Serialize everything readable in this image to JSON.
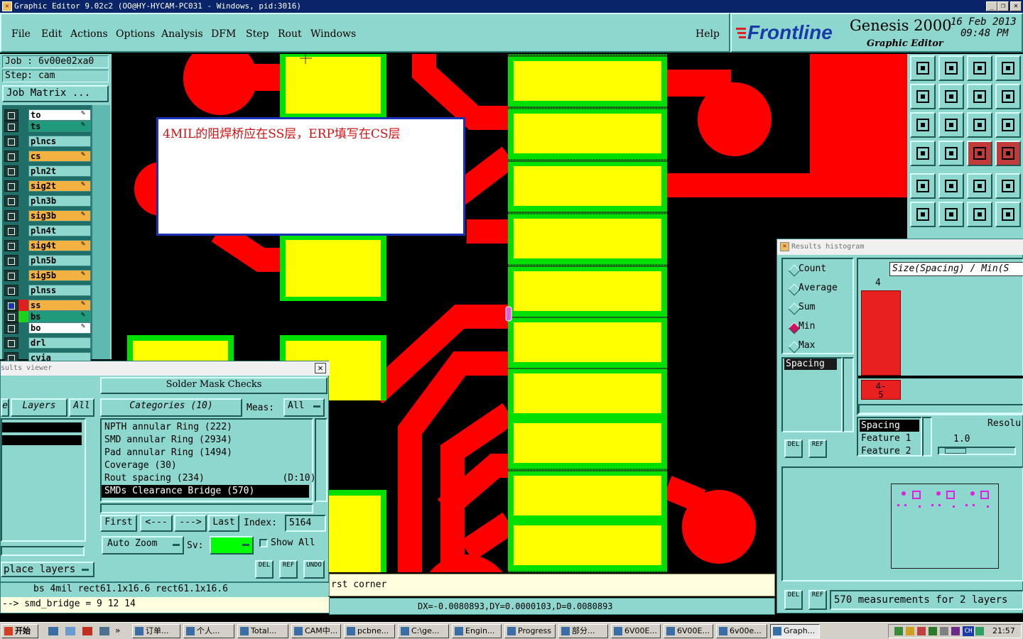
{
  "window": {
    "title": "Graphic Editor 9.02c2 (OO@HY-HYCAM-PC031 - Windows, pid:3016)",
    "buttons": [
      "_",
      "❐",
      "✕"
    ]
  },
  "menu": [
    "File",
    "Edit",
    "Actions",
    "Options",
    "Analysis",
    "DFM",
    "Step",
    "Rout",
    "Windows"
  ],
  "help_label": "Help",
  "brand": {
    "logo": "Frontline",
    "product": "Genesis 2000",
    "subtitle": "Graphic Editor",
    "date": "16 Feb 2013",
    "time": "09:48 PM"
  },
  "job": {
    "job_line": "Job : 6v00e02xa0",
    "step_line": "Step: cam",
    "matrix_button": "Job Matrix ..."
  },
  "layers": [
    {
      "name": "to",
      "color": "#ffffff",
      "swatch": "",
      "edit": true
    },
    {
      "name": "ts",
      "color": "#1f9a7a",
      "swatch": "",
      "edit": true
    },
    {
      "name": "plncs",
      "color": "#8ed7cf",
      "swatch": "",
      "edit": false
    },
    {
      "name": "cs",
      "color": "#f3b142",
      "swatch": "",
      "edit": true
    },
    {
      "name": "pln2t",
      "color": "#8ed7cf",
      "swatch": "",
      "edit": false
    },
    {
      "name": "sig2t",
      "color": "#f3b142",
      "swatch": "",
      "edit": true
    },
    {
      "name": "pln3b",
      "color": "#8ed7cf",
      "swatch": "",
      "edit": false
    },
    {
      "name": "sig3b",
      "color": "#f3b142",
      "swatch": "",
      "edit": true
    },
    {
      "name": "pln4t",
      "color": "#8ed7cf",
      "swatch": "",
      "edit": false
    },
    {
      "name": "sig4t",
      "color": "#f3b142",
      "swatch": "",
      "edit": true
    },
    {
      "name": "pln5b",
      "color": "#8ed7cf",
      "swatch": "",
      "edit": false
    },
    {
      "name": "sig5b",
      "color": "#f3b142",
      "swatch": "",
      "edit": true
    },
    {
      "name": "plnss",
      "color": "#8ed7cf",
      "swatch": "",
      "edit": false
    },
    {
      "name": "ss",
      "color": "#f3b142",
      "swatch": "#e02020",
      "edit": true
    },
    {
      "name": "bs",
      "color": "#1f9a7a",
      "swatch": "#20d020",
      "edit": true
    },
    {
      "name": "bo",
      "color": "#ffffff",
      "swatch": "",
      "edit": true
    },
    {
      "name": "drl",
      "color": "#8ed7cf",
      "swatch": "",
      "edit": false
    },
    {
      "name": "cvia",
      "color": "#8ed7cf",
      "swatch": "",
      "edit": false
    }
  ],
  "note": {
    "text": "4MIL的阻焊桥应在SS层，ERP填写在CS层"
  },
  "results_viewer": {
    "title": "sults viewer",
    "header": "Solder Mask Checks",
    "left_tab": "e",
    "layers_tab": "Layers",
    "all_tab": "All",
    "categories_tab": "Categories (10)",
    "meas_label": "Meas:",
    "meas_value": "All",
    "categories": [
      "NPTH annular Ring (222)",
      "SMD annular Ring (2934)",
      "Pad annular Ring (1494)",
      "Coverage (30)",
      "Rout spacing (234)              (D:10)",
      "SMDs Clearance Bridge (570)"
    ],
    "selected_index": 5,
    "nav": {
      "first": "First",
      "prev": "<---",
      "next": "--->",
      "last": "Last",
      "index_label": "Index:",
      "index_value": "5164"
    },
    "zoom": "Auto Zoom",
    "sv_label": "Sv:",
    "show_all": "Show All",
    "replace_layers": "place layers",
    "icons": [
      "DEL",
      "REF",
      "UNDO"
    ],
    "footer1": "bs 4mil   rect61.1x16.6   rect61.1x16.6",
    "footer2": "--> smd_bridge = 9 12 14"
  },
  "histogram": {
    "title": "Results histogram",
    "modes": [
      "Count",
      "Average",
      "Sum",
      "Min",
      "Max"
    ],
    "selected_mode": "Min",
    "header": "Size(Spacing) / Min(S",
    "bar_value_label": "4",
    "bar_range_label": "4-\n5",
    "bar_fill": 1.0,
    "list_item": "Spacing",
    "features": [
      "Spacing",
      "Feature 1",
      "Feature 2"
    ],
    "resolution_label": "Resolu",
    "resolution_value": "1.0",
    "status": "570 measurements for 2 layers",
    "icons": [
      "DEL",
      "REF"
    ]
  },
  "command_line": {
    "prompt": "rst corner",
    "coords": "DX=-0.0080893,DY=0.0000103,D=0.0080893"
  },
  "colors": {
    "teal": "#8ed7cf",
    "pad_yellow": "#ffff00",
    "mask_green": "#00e000",
    "trace_red": "#ff0000",
    "note_border": "#1832b8",
    "note_text": "#d01010"
  },
  "taskbar": {
    "start": "开始",
    "tasks": [
      "订单...",
      "个人...",
      "Total...",
      "CAM中...",
      "pcbne...",
      "C:\\ge...",
      "Engin...",
      "Progress",
      "部分...",
      "6V00E...",
      "6V00E...",
      "6v00e...",
      "Graph..."
    ],
    "active_task": "Graph...",
    "lang": "CH",
    "clock": "21:57"
  }
}
